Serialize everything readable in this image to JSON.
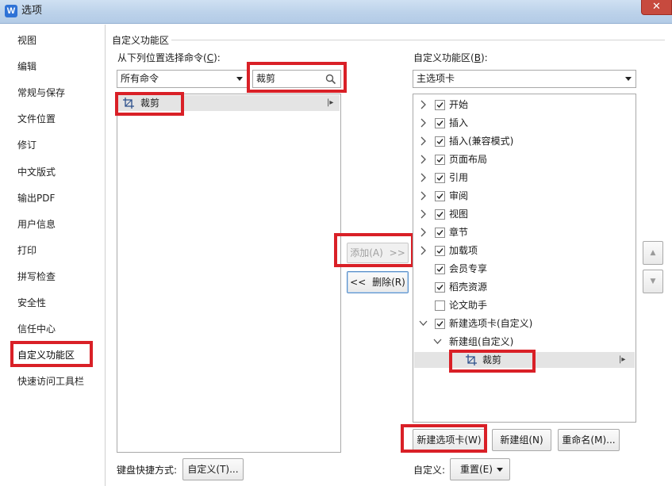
{
  "window": {
    "title": "选项",
    "logo_letter": "W",
    "close_glyph": "✕"
  },
  "nav": {
    "items": [
      "视图",
      "编辑",
      "常规与保存",
      "文件位置",
      "修订",
      "中文版式",
      "输出PDF",
      "用户信息",
      "打印",
      "拼写检查",
      "安全性",
      "信任中心",
      "自定义功能区",
      "快速访问工具栏"
    ],
    "selected_index": 12
  },
  "group_title": "自定义功能区",
  "left_panel": {
    "choose_label": "从下列位置选择命令",
    "choose_accel": "C",
    "source_combo_value": "所有命令",
    "search_value": "裁剪",
    "commands": [
      {
        "label": "裁剪",
        "icon": "crop-icon",
        "expand_glyph": "|▸"
      }
    ]
  },
  "middle": {
    "add_label": "添加(A)",
    "add_arrows": ">>",
    "remove_arrows": "<<",
    "remove_label": "删除(R)"
  },
  "right_panel": {
    "customize_label": "自定义功能区",
    "customize_accel": "B",
    "tabs_combo_value": "主选项卡",
    "tree": [
      {
        "label": "开始",
        "checked": true,
        "expand": "collapsed",
        "level": 0
      },
      {
        "label": "插入",
        "checked": true,
        "expand": "collapsed",
        "level": 0
      },
      {
        "label": "插入(兼容模式)",
        "checked": true,
        "expand": "collapsed",
        "level": 0
      },
      {
        "label": "页面布局",
        "checked": true,
        "expand": "collapsed",
        "level": 0
      },
      {
        "label": "引用",
        "checked": true,
        "expand": "collapsed",
        "level": 0
      },
      {
        "label": "审阅",
        "checked": true,
        "expand": "collapsed",
        "level": 0
      },
      {
        "label": "视图",
        "checked": true,
        "expand": "collapsed",
        "level": 0
      },
      {
        "label": "章节",
        "checked": true,
        "expand": "collapsed",
        "level": 0
      },
      {
        "label": "加载项",
        "checked": true,
        "expand": "collapsed",
        "level": 0
      },
      {
        "label": "会员专享",
        "checked": true,
        "expand": "none",
        "level": 0
      },
      {
        "label": "稻壳资源",
        "checked": true,
        "expand": "none",
        "level": 0
      },
      {
        "label": "论文助手",
        "checked": false,
        "expand": "none",
        "level": 0
      },
      {
        "label": "新建选项卡(自定义)",
        "checked": true,
        "expand": "expanded",
        "level": 0
      },
      {
        "label": "新建组(自定义)",
        "checked": null,
        "expand": "expanded",
        "level": 1
      },
      {
        "label": "裁剪",
        "checked": null,
        "expand": "none",
        "level": 2,
        "icon": "crop-icon"
      }
    ],
    "move_up_glyph": "▲",
    "move_down_glyph": "▼",
    "new_tab_label": "新建选项卡(W)",
    "new_group_label": "新建组(N)",
    "rename_label": "重命名(M)...",
    "customize_row_label": "自定义:",
    "reset_label": "重置(E)"
  },
  "keyboard": {
    "label": "键盘快捷方式:",
    "button_label": "自定义(T)..."
  },
  "colors": {
    "highlight_red": "#d92027",
    "selection_gray": "#e4e4e4",
    "title_blue": "#2f72d6"
  }
}
